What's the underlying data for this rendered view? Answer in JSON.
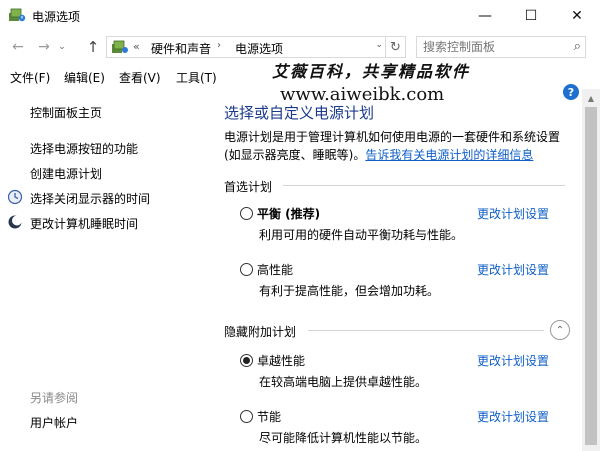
{
  "window": {
    "title": "电源选项",
    "minimize": "—",
    "maximize": "☐",
    "close": "✕"
  },
  "address": {
    "back": "←",
    "forward": "→",
    "history": "⌄",
    "up": "↑",
    "chevron": "«",
    "crumbs": [
      "硬件和声音",
      "电源选项"
    ],
    "separator": "›",
    "dropdown": "⌄",
    "refresh": "↻",
    "search_placeholder": "搜索控制面板",
    "search_icon": "⌕"
  },
  "menu": [
    "文件(F)",
    "编辑(E)",
    "查看(V)",
    "工具(T)"
  ],
  "watermark": {
    "line1": "艾薇百科，共享精品软件",
    "line2": "www.aiweibk.com"
  },
  "help": "?",
  "sidebar": {
    "home": "控制面板主页",
    "links": [
      "选择电源按钮的功能",
      "创建电源计划",
      "选择关闭显示器的时间",
      "更改计算机睡眠时间"
    ],
    "see_also_heading": "另请参阅",
    "see_also": [
      "用户帐户"
    ]
  },
  "main": {
    "title": "选择或自定义电源计划",
    "desc_text": "电源计划是用于管理计算机如何使用电源的一套硬件和系统设置(如显示器亮度、睡眠等)。",
    "desc_link": "告诉我有关电源计划的详细信息",
    "preferred_heading": "首选计划",
    "hidden_heading": "隐藏附加计划",
    "expander": "⌃",
    "change_label": "更改计划设置",
    "plans": [
      {
        "name": "平衡 (推荐)",
        "desc": "利用可用的硬件自动平衡功耗与性能。",
        "checked": false
      },
      {
        "name": "高性能",
        "desc": "有利于提高性能，但会增加功耗。",
        "checked": false
      },
      {
        "name": "卓越性能",
        "desc": "在较高端电脑上提供卓越性能。",
        "checked": true
      },
      {
        "name": "节能",
        "desc": "尽可能降低计算机性能以节能。",
        "checked": false
      }
    ]
  },
  "scrollbar": {
    "up": "▲"
  },
  "colors": {
    "link": "#0f5fc7",
    "title": "#1a3a8c",
    "help": "#1e6fce"
  }
}
